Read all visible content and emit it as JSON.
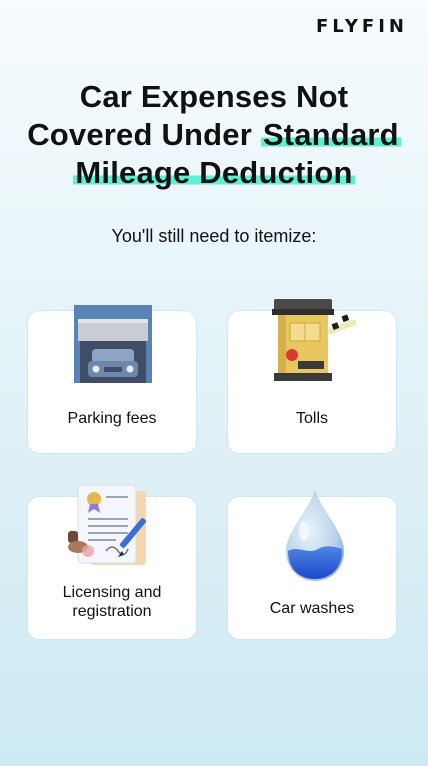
{
  "brand": "FLYFIN",
  "title": {
    "line1": "Car Expenses Not",
    "line2_plain": "Covered Under ",
    "line2_highlight": "Standard",
    "line3_highlight": "Mileage Deduction"
  },
  "subtitle": "You'll still need to itemize:",
  "colors": {
    "highlight": "#5ef0d2",
    "card_border": "#cfe9f2"
  },
  "cards": [
    {
      "label": "Parking fees",
      "icon": "parking-garage-icon"
    },
    {
      "label": "Tolls",
      "icon": "toll-booth-icon"
    },
    {
      "label_line1": "Licensing and",
      "label_line2": "registration",
      "icon": "certificate-document-icon"
    },
    {
      "label": "Car washes",
      "icon": "water-drop-icon"
    }
  ]
}
